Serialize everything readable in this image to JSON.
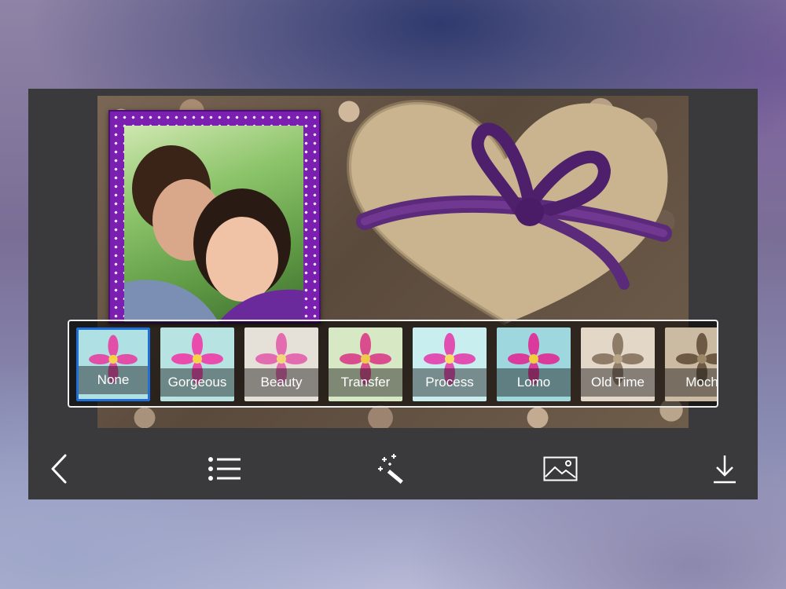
{
  "filters": [
    {
      "label": "None",
      "tone": "color",
      "selected": true
    },
    {
      "label": "Gorgeous",
      "tone": "color",
      "selected": false
    },
    {
      "label": "Beauty",
      "tone": "soft",
      "selected": false
    },
    {
      "label": "Transfer",
      "tone": "warm",
      "selected": false
    },
    {
      "label": "Process",
      "tone": "cool",
      "selected": false
    },
    {
      "label": "Lomo",
      "tone": "color",
      "selected": false
    },
    {
      "label": "Old Time",
      "tone": "sepia",
      "selected": false
    },
    {
      "label": "Moch",
      "tone": "sepia-dark",
      "selected": false
    }
  ],
  "toolbar": {
    "back_icon": "chevron-left-icon",
    "list_icon": "list-icon",
    "effects_icon": "magic-wand-icon",
    "background_icon": "image-icon",
    "download_icon": "download-icon"
  },
  "colors": {
    "selected_border": "#1e6fd9",
    "frame": "#7a1fb0",
    "toolbar": "#3a3a3c",
    "icon": "#ffffff"
  }
}
